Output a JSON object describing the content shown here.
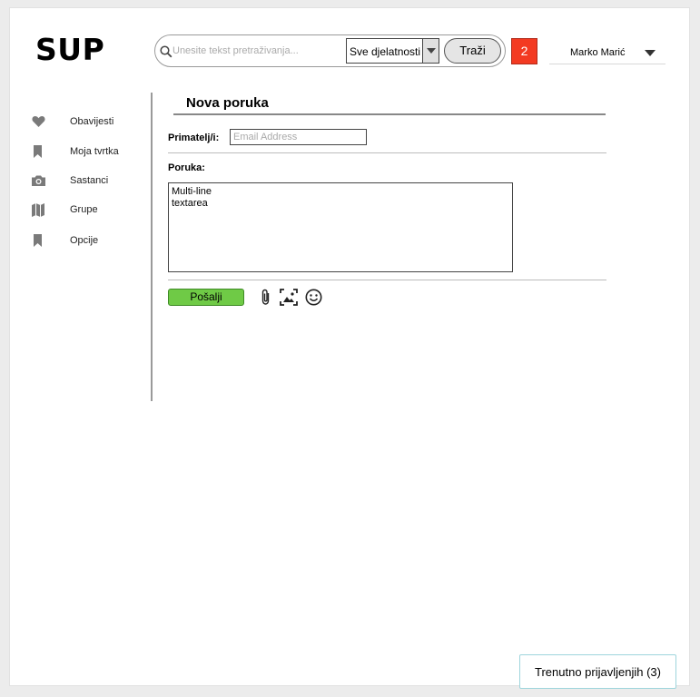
{
  "app": {
    "logo": "SUP"
  },
  "header": {
    "search": {
      "placeholder": "Unesite tekst pretraživanja...",
      "value": ""
    },
    "scope_select": {
      "selected": "Sve djelatnosti"
    },
    "search_button": "Traži",
    "notifications_count": "2",
    "user": {
      "name": "Marko Marić"
    }
  },
  "sidebar": {
    "items": [
      {
        "label": "Obavijesti",
        "icon": "heart-icon"
      },
      {
        "label": "Moja tvrtka",
        "icon": "bookmark-icon"
      },
      {
        "label": "Sastanci",
        "icon": "camera-icon"
      },
      {
        "label": "Grupe",
        "icon": "map-icon"
      },
      {
        "label": "Opcije",
        "icon": "bookmark-icon"
      }
    ]
  },
  "compose": {
    "title": "Nova poruka",
    "recipients_label": "Primatelj/i:",
    "recipients_placeholder": "Email Address",
    "message_label": "Poruka:",
    "message_text": "Multi-line\ntextarea",
    "send_button": "Pošalji",
    "tools": [
      "paperclip-icon",
      "image-icon",
      "smiley-icon"
    ]
  },
  "footer": {
    "online_button": "Trenutno prijavljenjih (3)"
  },
  "colors": {
    "notification": "#f33a22",
    "send": "#6fca46",
    "online_border": "#9ed5dc"
  }
}
